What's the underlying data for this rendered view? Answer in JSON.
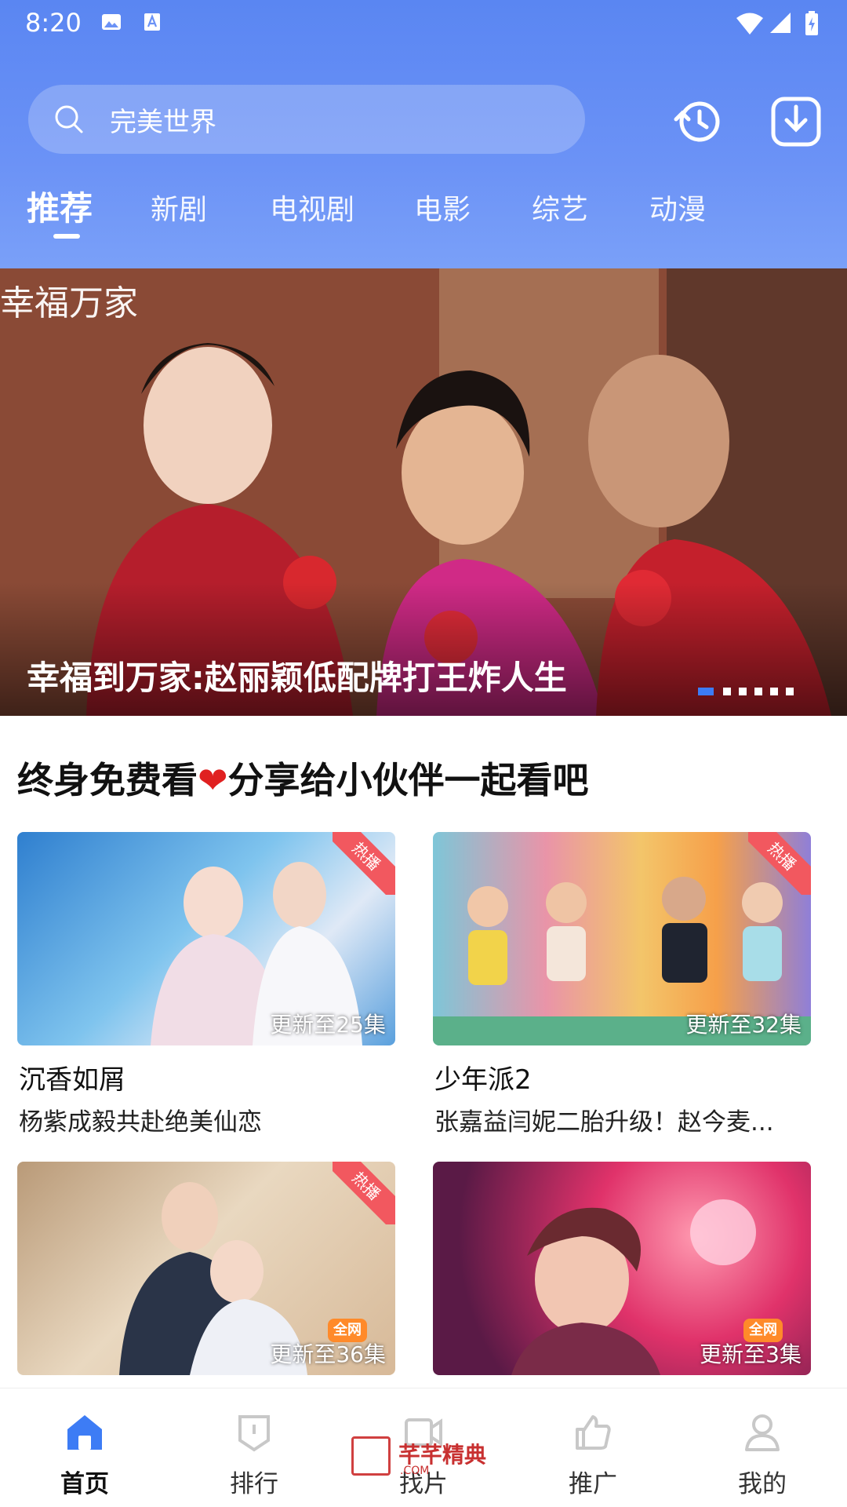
{
  "status_bar": {
    "time": "8:20"
  },
  "search": {
    "query": "完美世界"
  },
  "tabs": [
    {
      "label": "推荐",
      "active": true
    },
    {
      "label": "新剧"
    },
    {
      "label": "电视剧"
    },
    {
      "label": "电影"
    },
    {
      "label": "综艺"
    },
    {
      "label": "动漫"
    }
  ],
  "banner": {
    "logo": "幸福万家",
    "title": "幸福到万家:赵丽颖低配牌打王炸人生",
    "dot_count": 6,
    "active_dot": 0
  },
  "section": {
    "title_before": "终身免费看",
    "heart": "❤",
    "title_after": "分享给小伙伴一起看吧"
  },
  "cards": [
    {
      "title": "沉香如屑",
      "subtitle": "杨紫成毅共赴绝美仙恋",
      "episodes": "更新至25集",
      "badge": "热播"
    },
    {
      "title": "少年派2",
      "subtitle": "张嘉益闫妮二胎升级！赵今麦...",
      "episodes": "更新至32集",
      "badge": "热播"
    },
    {
      "title": "",
      "subtitle": "",
      "episodes": "更新至36集",
      "badge": "热播",
      "net": "全网"
    },
    {
      "title": "",
      "subtitle": "",
      "episodes": "更新至3集",
      "net": "全网"
    }
  ],
  "bottom_nav": [
    {
      "label": "首页",
      "icon": "home-icon",
      "active": true
    },
    {
      "label": "排行",
      "icon": "rank-icon"
    },
    {
      "label": "找片",
      "icon": "film-icon"
    },
    {
      "label": "推广",
      "icon": "thumbs-up-icon"
    },
    {
      "label": "我的",
      "icon": "profile-icon"
    }
  ],
  "watermark": {
    "text": "芊芊精典",
    "sub": ".COM"
  },
  "colors": {
    "accent": "#3d7cf5",
    "header_top": "#5a86f2",
    "hot_badge": "#f2585f",
    "heart": "#e02020"
  }
}
